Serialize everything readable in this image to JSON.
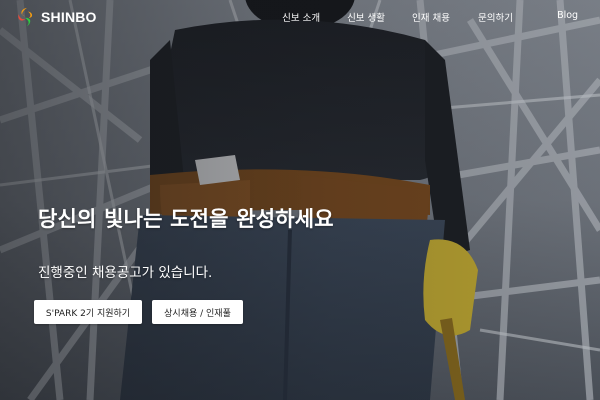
{
  "brand": {
    "name": "SHINBO",
    "colors": {
      "orange": "#f39c12",
      "green": "#2ecc40",
      "red": "#e74c3c"
    }
  },
  "nav": {
    "items": [
      {
        "label": "신보 소개"
      },
      {
        "label": "신보 생활"
      },
      {
        "label": "인재 채용"
      },
      {
        "label": "문의하기"
      },
      {
        "label": "Blog"
      }
    ]
  },
  "hero": {
    "headline": "당신의 빛나는 도전을 완성하세요",
    "subline": "진행중인 채용공고가 있습니다.",
    "buttons": {
      "spark": "S'PARK 2기 지원하기",
      "regular": "상시채용 / 인재풀"
    },
    "background_icon": "construction-worker-photo"
  }
}
